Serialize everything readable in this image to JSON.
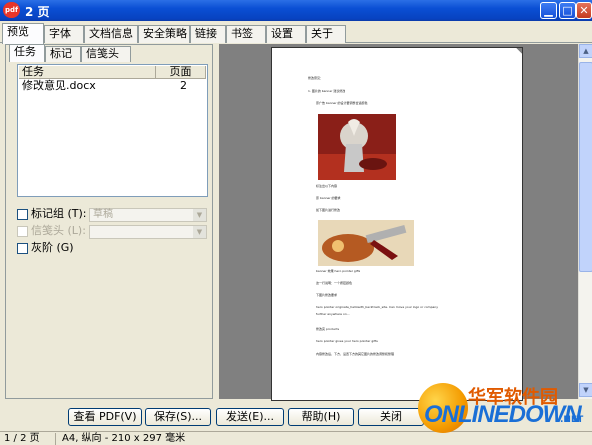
{
  "window": {
    "app_icon": "pdf",
    "title": "2 页",
    "controls": {
      "minimize": "▁",
      "maximize": "□",
      "close": "✕"
    }
  },
  "tabs": [
    "预览",
    "字体",
    "文档信息",
    "安全策略",
    "链接",
    "书签",
    "设置",
    "关于"
  ],
  "subtabs": [
    "任务",
    "标记",
    "信笺头"
  ],
  "task_list": {
    "columns": [
      "任务",
      "页面"
    ],
    "rows": [
      {
        "name": "修改意见.docx",
        "pages": "2"
      }
    ]
  },
  "options": {
    "mark_group": {
      "label": "标记组 (T):",
      "value": "草稿"
    },
    "letterhead": {
      "label": "信笺头 (L):",
      "value": ""
    },
    "grayscale": {
      "label": "灰阶 (G)"
    }
  },
  "document_text": {
    "line1": "修改意见：",
    "line2": "1. 图片的 banner 建议修改",
    "line3": "原广告 banner 的设计要调整合适颜色",
    "line4": "标注出以下内容",
    "line5": "原 banner 的要求",
    "line6": "如下图片进行修改",
    "line7": "banner 效果 hero pointer gifts",
    "line8": "这一行说明：一个按钮颜色",
    "line9": "下图片修改要求",
    "line10": "hero pointer originate_hellowith_backtrack_site. Can move your logo or company",
    "line11": "further anywhere on...",
    "line12": "修改完 products",
    "line13": "hero pointer gives your hero pointer gifts",
    "line14": "内容修改后，下方，设置下方的其它图片的修改调整和整理"
  },
  "buttons": {
    "view_pdf": "查看 PDF(V)",
    "save": "保存(S)...",
    "send": "发送(E)...",
    "help": "帮助(H)",
    "close": "关闭"
  },
  "status": {
    "page": "1 / 2 页",
    "size": "A4, 纵向 - 210 x 297 毫米"
  },
  "watermark": {
    "cn": "华军软件园",
    "en": "ONLINEDOWN",
    "com": ".NET"
  },
  "colors": {
    "titlebar": "#0a4fd4",
    "dialog_bg": "#ece9d8",
    "preview_bg": "#808080",
    "watermark_orange": "#e05a00",
    "watermark_blue": "#1a6fd6"
  }
}
